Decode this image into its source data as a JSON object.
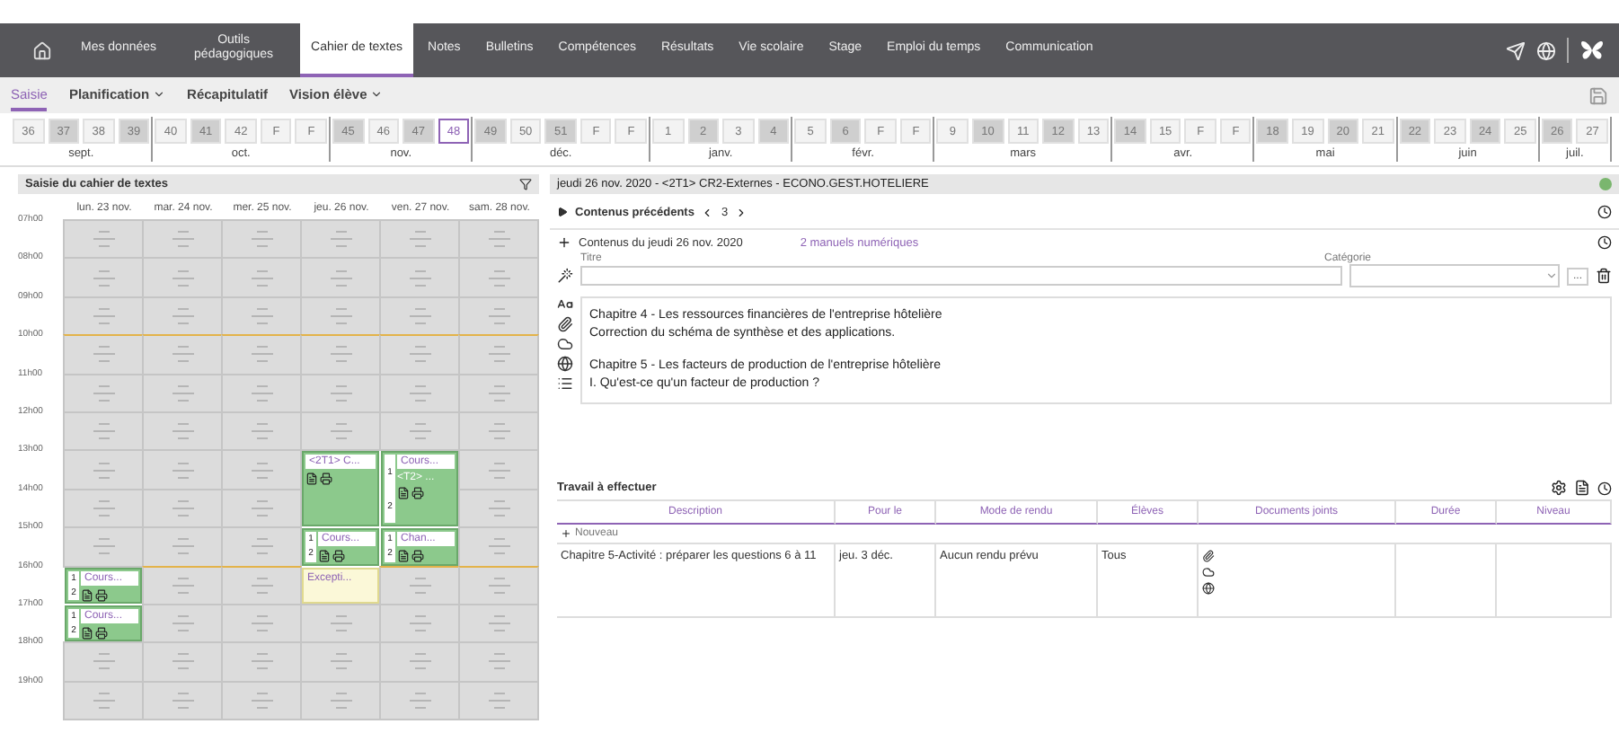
{
  "nav": {
    "items": [
      {
        "label": "Mes données",
        "selected": false
      },
      {
        "label": "Outils pédagogiques",
        "selected": false
      },
      {
        "label": "Cahier de textes",
        "selected": true
      },
      {
        "label": "Notes",
        "selected": false
      },
      {
        "label": "Bulletins",
        "selected": false
      },
      {
        "label": "Compétences",
        "selected": false
      },
      {
        "label": "Résultats",
        "selected": false
      },
      {
        "label": "Vie scolaire",
        "selected": false
      },
      {
        "label": "Stage",
        "selected": false
      },
      {
        "label": "Emploi du temps",
        "selected": false
      },
      {
        "label": "Communication",
        "selected": false
      }
    ]
  },
  "subnav": [
    {
      "label": "Saisie",
      "selected": true,
      "dropdown": false
    },
    {
      "label": "Planification",
      "selected": false,
      "dropdown": true
    },
    {
      "label": "Récapitulatif",
      "selected": false,
      "dropdown": false
    },
    {
      "label": "Vision élève",
      "selected": false,
      "dropdown": true
    }
  ],
  "months": [
    {
      "label": "sept.",
      "weeks": [
        {
          "label": "36",
          "shaded": false,
          "selected": false
        },
        {
          "label": "37",
          "shaded": true,
          "selected": false
        },
        {
          "label": "38",
          "shaded": false,
          "selected": false
        },
        {
          "label": "39",
          "shaded": true,
          "selected": false
        }
      ]
    },
    {
      "label": "oct.",
      "weeks": [
        {
          "label": "40",
          "shaded": false,
          "selected": false
        },
        {
          "label": "41",
          "shaded": true,
          "selected": false
        },
        {
          "label": "42",
          "shaded": false,
          "selected": false
        },
        {
          "label": "F",
          "shaded": false,
          "selected": false
        },
        {
          "label": "F",
          "shaded": false,
          "selected": false
        }
      ]
    },
    {
      "label": "nov.",
      "weeks": [
        {
          "label": "45",
          "shaded": true,
          "selected": false
        },
        {
          "label": "46",
          "shaded": false,
          "selected": false
        },
        {
          "label": "47",
          "shaded": true,
          "selected": false
        },
        {
          "label": "48",
          "shaded": false,
          "selected": true
        }
      ]
    },
    {
      "label": "déc.",
      "weeks": [
        {
          "label": "49",
          "shaded": true,
          "selected": false
        },
        {
          "label": "50",
          "shaded": false,
          "selected": false
        },
        {
          "label": "51",
          "shaded": true,
          "selected": false
        },
        {
          "label": "F",
          "shaded": false,
          "selected": false
        },
        {
          "label": "F",
          "shaded": false,
          "selected": false
        }
      ]
    },
    {
      "label": "janv.",
      "weeks": [
        {
          "label": "1",
          "shaded": false,
          "selected": false
        },
        {
          "label": "2",
          "shaded": true,
          "selected": false
        },
        {
          "label": "3",
          "shaded": false,
          "selected": false
        },
        {
          "label": "4",
          "shaded": true,
          "selected": false
        }
      ]
    },
    {
      "label": "févr.",
      "weeks": [
        {
          "label": "5",
          "shaded": false,
          "selected": false
        },
        {
          "label": "6",
          "shaded": true,
          "selected": false
        },
        {
          "label": "F",
          "shaded": false,
          "selected": false
        },
        {
          "label": "F",
          "shaded": false,
          "selected": false
        }
      ]
    },
    {
      "label": "mars",
      "weeks": [
        {
          "label": "9",
          "shaded": false,
          "selected": false
        },
        {
          "label": "10",
          "shaded": true,
          "selected": false
        },
        {
          "label": "11",
          "shaded": false,
          "selected": false
        },
        {
          "label": "12",
          "shaded": true,
          "selected": false
        },
        {
          "label": "13",
          "shaded": false,
          "selected": false
        }
      ]
    },
    {
      "label": "avr.",
      "weeks": [
        {
          "label": "14",
          "shaded": true,
          "selected": false
        },
        {
          "label": "15",
          "shaded": false,
          "selected": false
        },
        {
          "label": "F",
          "shaded": false,
          "selected": false
        },
        {
          "label": "F",
          "shaded": false,
          "selected": false
        }
      ]
    },
    {
      "label": "mai",
      "weeks": [
        {
          "label": "18",
          "shaded": true,
          "selected": false
        },
        {
          "label": "19",
          "shaded": false,
          "selected": false
        },
        {
          "label": "20",
          "shaded": true,
          "selected": false
        },
        {
          "label": "21",
          "shaded": false,
          "selected": false
        }
      ]
    },
    {
      "label": "juin",
      "weeks": [
        {
          "label": "22",
          "shaded": true,
          "selected": false
        },
        {
          "label": "23",
          "shaded": false,
          "selected": false
        },
        {
          "label": "24",
          "shaded": true,
          "selected": false
        },
        {
          "label": "25",
          "shaded": false,
          "selected": false
        }
      ]
    },
    {
      "label": "juil.",
      "weeks": [
        {
          "label": "26",
          "shaded": true,
          "selected": false
        },
        {
          "label": "27",
          "shaded": false,
          "selected": false
        }
      ]
    }
  ],
  "timetable": {
    "title": "Saisie du cahier de textes",
    "hours": [
      "07h00",
      "08h00",
      "09h00",
      "10h00",
      "11h00",
      "12h00",
      "13h00",
      "14h00",
      "15h00",
      "16h00",
      "17h00",
      "18h00",
      "19h00"
    ],
    "days": [
      {
        "label": "lun. 23 nov.",
        "slots": [
          {
            "kind": "empty"
          },
          {
            "kind": "empty"
          },
          {
            "kind": "empty"
          },
          {
            "kind": "empty"
          },
          {
            "kind": "empty"
          },
          {
            "kind": "empty"
          },
          {
            "kind": "empty"
          },
          {
            "kind": "empty"
          },
          {
            "kind": "empty"
          },
          {
            "kind": "course",
            "label": "Cours...",
            "marks": [
              "1",
              "2"
            ]
          },
          {
            "kind": "course",
            "label": "Cours...",
            "marks": [
              "1",
              "2"
            ]
          },
          {
            "kind": "empty"
          },
          {
            "kind": "empty"
          }
        ]
      },
      {
        "label": "mar. 24 nov.",
        "slots": [
          {
            "kind": "empty"
          },
          {
            "kind": "empty"
          },
          {
            "kind": "empty"
          },
          {
            "kind": "empty"
          },
          {
            "kind": "empty"
          },
          {
            "kind": "empty"
          },
          {
            "kind": "empty"
          },
          {
            "kind": "empty"
          },
          {
            "kind": "empty"
          },
          {
            "kind": "empty"
          },
          {
            "kind": "empty"
          },
          {
            "kind": "empty"
          },
          {
            "kind": "empty"
          }
        ]
      },
      {
        "label": "mer. 25 nov.",
        "slots": [
          {
            "kind": "empty"
          },
          {
            "kind": "empty"
          },
          {
            "kind": "empty"
          },
          {
            "kind": "empty"
          },
          {
            "kind": "empty"
          },
          {
            "kind": "empty"
          },
          {
            "kind": "empty"
          },
          {
            "kind": "empty"
          },
          {
            "kind": "empty"
          },
          {
            "kind": "empty"
          },
          {
            "kind": "empty"
          },
          {
            "kind": "empty"
          },
          {
            "kind": "empty"
          }
        ]
      },
      {
        "label": "jeu. 26 nov.",
        "slots": [
          {
            "kind": "empty"
          },
          {
            "kind": "empty"
          },
          {
            "kind": "empty"
          },
          {
            "kind": "empty"
          },
          {
            "kind": "empty"
          },
          {
            "kind": "empty"
          },
          {
            "kind": "course",
            "label": "<2T1> C..."
          },
          {
            "kind": "continuation"
          },
          {
            "kind": "course",
            "label": "Cours...",
            "marks": [
              "1",
              "2"
            ]
          },
          {
            "kind": "exception",
            "label": "Excepti..."
          },
          {
            "kind": "empty"
          },
          {
            "kind": "empty"
          },
          {
            "kind": "empty"
          }
        ]
      },
      {
        "label": "ven. 27 nov.",
        "slots": [
          {
            "kind": "empty"
          },
          {
            "kind": "empty"
          },
          {
            "kind": "empty"
          },
          {
            "kind": "empty"
          },
          {
            "kind": "empty"
          },
          {
            "kind": "empty"
          },
          {
            "kind": "course",
            "label": "Cours...",
            "sub": "<T2> ...",
            "marks": [
              "1",
              "2"
            ]
          },
          {
            "kind": "continuation"
          },
          {
            "kind": "course",
            "label": "Chan...",
            "marks": [
              "1",
              "2"
            ]
          },
          {
            "kind": "empty"
          },
          {
            "kind": "empty"
          },
          {
            "kind": "empty"
          },
          {
            "kind": "empty"
          }
        ]
      },
      {
        "label": "sam. 28 nov.",
        "slots": [
          {
            "kind": "empty"
          },
          {
            "kind": "empty"
          },
          {
            "kind": "empty"
          },
          {
            "kind": "empty"
          },
          {
            "kind": "empty"
          },
          {
            "kind": "empty"
          },
          {
            "kind": "empty"
          },
          {
            "kind": "empty"
          },
          {
            "kind": "empty"
          },
          {
            "kind": "empty"
          },
          {
            "kind": "empty"
          },
          {
            "kind": "empty"
          },
          {
            "kind": "empty"
          }
        ]
      }
    ]
  },
  "detail": {
    "header": "jeudi 26 nov. 2020 - <2T1> CR2-Externes - ECONO.GEST.HOTELIERE",
    "previous": {
      "label": "Contenus précédents",
      "count": "3",
      "expanded": false
    },
    "content": {
      "label": "Contenus du jeudi 26 nov. 2020",
      "link": "2 manuels numériques",
      "title_label": "Titre",
      "category_label": "Catégorie",
      "more": "...",
      "lines": [
        "Chapitre 4 - Les ressources financières de l'entreprise hôtelière",
        "Correction du schéma de synthèse et des applications.",
        "Chapitre 5 - Les facteurs de production de l'entreprise hôtelière",
        "I. Qu'est-ce qu'un facteur de production ?"
      ]
    },
    "homework": {
      "title": "Travail à effectuer",
      "columns": [
        "Description",
        "Pour le",
        "Mode de rendu",
        "Élèves",
        "Documents joints",
        "Durée",
        "Niveau"
      ],
      "new_label": "Nouveau",
      "rows": [
        {
          "description": "Chapitre 5-Activité : préparer les questions 6 à 11",
          "due": "jeu. 3 déc.",
          "mode": "Aucun rendu prévu",
          "students": "Tous"
        }
      ]
    }
  }
}
